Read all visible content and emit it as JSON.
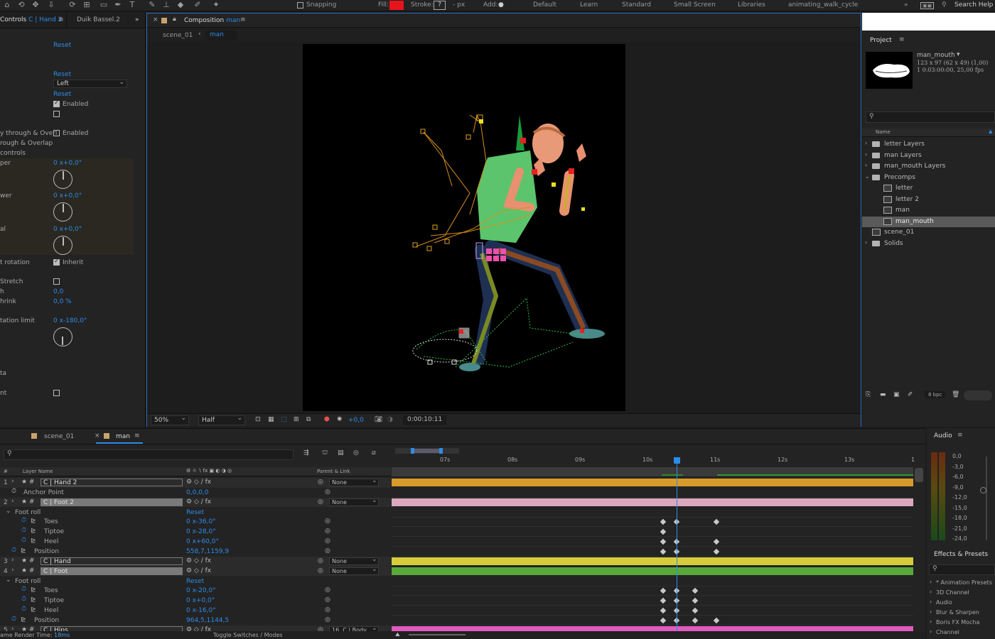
{
  "toolbar": {
    "snapping": "Snapping",
    "fill_label": "Fill:",
    "stroke_label": "Stroke:",
    "stroke_value": "?",
    "px_label": "- px",
    "add_label": "Add:",
    "workspaces": [
      "Default",
      "Learn",
      "Standard",
      "Small Screen",
      "Libraries",
      "animating_walk_cycle"
    ],
    "search_help": "Search Help",
    "fill_color": "#e8141c"
  },
  "effect_controls": {
    "tab_label": "Controls",
    "tab_layer": "C | Hand 2",
    "other_tab": "Duik Bassel.2",
    "rows": {
      "reset1": "Reset",
      "reset2": "Reset",
      "dropdown_left": "Left",
      "reset3": "Reset",
      "enabled1": "Enabled",
      "through_overlap1": "y through & Overl",
      "enabled2": "Enabled",
      "through_overlap2": "rough & Overlap",
      "controls": "controls",
      "per_label": "per",
      "per_value": "0 x+0,0°",
      "wer_label": "wer",
      "wer_value": "0 x+0,0°",
      "al_label": "al",
      "al_value": "0 x+0,0°",
      "rotation_label": "t rotation",
      "inherit": "Inherit",
      "stretch_label": "Stretch",
      "h_label": "h",
      "h_value": "0,0",
      "shrink_label": "hrink",
      "shrink_value": "0,0 %",
      "rotation_limit_label": "tation limit",
      "rotation_limit_value": "0 x-180,0°",
      "ta_label": "ta",
      "nt_label": "nt"
    }
  },
  "composition": {
    "title_prefix": "Composition",
    "title_name": "man",
    "crumb_parent": "scene_01",
    "crumb_current": "man",
    "zoom": "50%",
    "resolution": "Half",
    "exposure": "+0,0",
    "timecode": "0:00:10:11"
  },
  "project": {
    "title": "Project",
    "asset_name": "man_mouth",
    "asset_dims": "123 x 97  (62 x 49) (1,00)",
    "asset_duration": "1 0:03:00:00, 25,00 fps",
    "column_name": "Name",
    "bpc": "8 bpc",
    "items": [
      {
        "label": "letter Layers",
        "type": "folder",
        "indent": 0
      },
      {
        "label": "man Layers",
        "type": "folder",
        "indent": 0
      },
      {
        "label": "man_mouth Layers",
        "type": "folder",
        "indent": 0
      },
      {
        "label": "Precomps",
        "type": "folder",
        "indent": 0
      },
      {
        "label": "letter",
        "type": "comp",
        "indent": 1
      },
      {
        "label": "letter 2",
        "type": "comp",
        "indent": 1
      },
      {
        "label": "man",
        "type": "comp",
        "indent": 1
      },
      {
        "label": "man_mouth",
        "type": "comp",
        "indent": 1
      },
      {
        "label": "scene_01",
        "type": "comp",
        "indent": 0
      },
      {
        "label": "Solids",
        "type": "folder",
        "indent": 0
      }
    ]
  },
  "timeline": {
    "tab1": "scene_01",
    "tab2": "man",
    "col_num": "#",
    "col_layer": "Layer Name",
    "col_parent": "Parent & Link",
    "render_time_label": "ame Render Time:",
    "render_time_value": "18ms",
    "toggle_label": "Toggle Switches / Modes",
    "ruler": [
      "07s",
      "08s",
      "09s",
      "10s",
      "11s",
      "12s",
      "13s",
      "1"
    ],
    "rows": [
      {
        "kind": "layer",
        "num": "1",
        "name": "C | Hand 2",
        "parent": "None",
        "color": "#d89a2a"
      },
      {
        "kind": "prop",
        "name": "Anchor Point",
        "value": "0,0,0,0",
        "indent": 1
      },
      {
        "kind": "layer",
        "num": "2",
        "name": "C | Foot 2",
        "parent": "None",
        "color": "#dba8bd"
      },
      {
        "kind": "group",
        "name": "Foot roll",
        "value": "Reset"
      },
      {
        "kind": "prop",
        "name": "Toes",
        "value": "0 x-36,0°",
        "indent": 2
      },
      {
        "kind": "prop",
        "name": "Tiptoe",
        "value": "0 x-28,0°",
        "indent": 2
      },
      {
        "kind": "prop",
        "name": "Heel",
        "value": "0 x+60,0°",
        "indent": 2
      },
      {
        "kind": "prop",
        "name": "Position",
        "value": "558,7,1159,9",
        "indent": 1
      },
      {
        "kind": "layer",
        "num": "3",
        "name": "C | Hand",
        "parent": "None",
        "color": "#d6cc3c"
      },
      {
        "kind": "layer",
        "num": "4",
        "name": "C | Foot",
        "parent": "None",
        "color": "#5aa83a"
      },
      {
        "kind": "group",
        "name": "Foot roll",
        "value": "Reset"
      },
      {
        "kind": "prop",
        "name": "Toes",
        "value": "0 x-20,0°",
        "indent": 2
      },
      {
        "kind": "prop",
        "name": "Tiptoe",
        "value": "0 x+0,0°",
        "indent": 2
      },
      {
        "kind": "prop",
        "name": "Heel",
        "value": "0 x-16,0°",
        "indent": 2
      },
      {
        "kind": "prop",
        "name": "Position",
        "value": "964,5,1144,5",
        "indent": 1
      },
      {
        "kind": "layer",
        "num": "5",
        "name": "C | Hips",
        "parent": "16. C | Body",
        "color": "#e05ac0"
      }
    ]
  },
  "audio": {
    "title": "Audio",
    "levels": [
      "0,0",
      "-3,0",
      "-6,0",
      "-9,0",
      "-12,0",
      "-15,0",
      "-18,0",
      "-21,0",
      "-24,0"
    ]
  },
  "effects_presets": {
    "title": "Effects & Presets",
    "items": [
      "* Animation Presets",
      "3D Channel",
      "Audio",
      "Blur & Sharpen",
      "Boris FX Mocha",
      "Channel"
    ]
  }
}
